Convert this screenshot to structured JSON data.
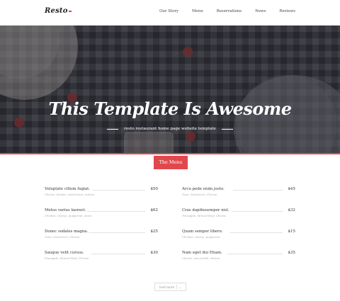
{
  "logo": "Resto",
  "nav": [
    "Our Story",
    "Menu",
    "Reservations",
    "News",
    "Reviews"
  ],
  "hero": {
    "title": "This Template Is Awesome",
    "subtitle": "resto restaurant home page website template"
  },
  "section_tab": "The Menu",
  "menu_left": [
    {
      "name": "Voluptate cillum fugiat.",
      "desc": "Cheese, tomato, mushrooms, onions.",
      "price": "$50"
    },
    {
      "name": "Metus varius laoreet.",
      "desc": "Chicken, cheese, pepperoni, onion.",
      "price": "$62"
    },
    {
      "name": "Donec sodales magna.",
      "desc": "Tuna, Sweetcorn, Cheese.",
      "price": "$25"
    },
    {
      "name": "Saugue velit cursus.",
      "desc": "Pineapple, Minced Beef, Cheese.",
      "price": "$30"
    }
  ],
  "menu_right": [
    {
      "name": "Arcu pede enim justo.",
      "desc": "Tuna, Sweetcorn, Cheese.",
      "price": "$45"
    },
    {
      "name": "Cras dapibusempor nisl.",
      "desc": "Pineapple, Minced Beef, Cheese.",
      "price": "$32"
    },
    {
      "name": "Quam semper libero.",
      "desc": "Chicken, cheese, pepperoni.",
      "price": "$15"
    },
    {
      "name": "Nam eget dui Etiam.",
      "desc": "Cheese, mozzarella, cheese.",
      "price": "$35"
    }
  ],
  "load_more": "load more",
  "colors": {
    "accent": "#e0484d"
  }
}
